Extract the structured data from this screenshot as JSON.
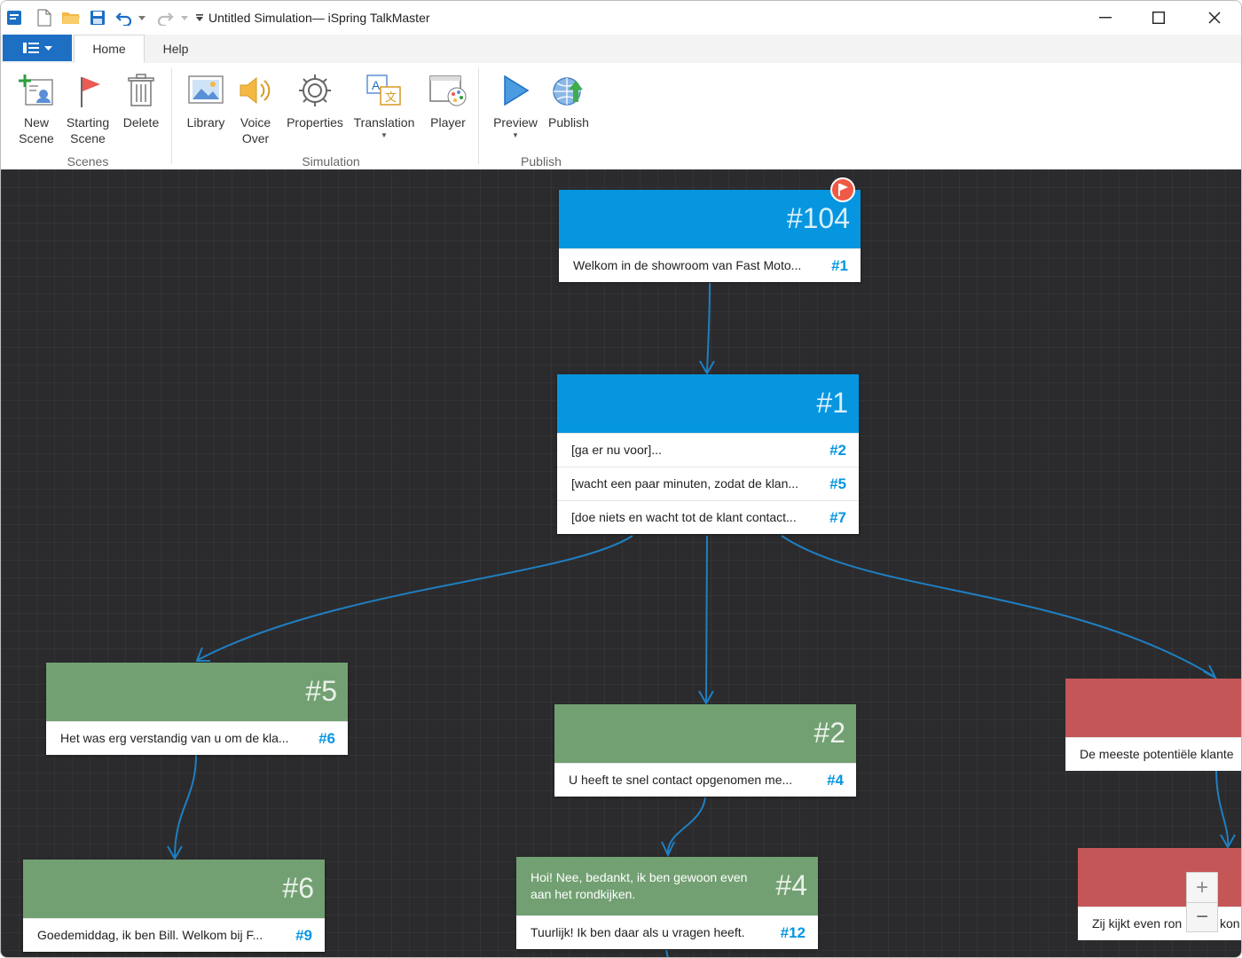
{
  "window": {
    "title": "Untitled Simulation— iSpring TalkMaster"
  },
  "tabs": {
    "home": "Home",
    "help": "Help"
  },
  "ribbon": {
    "new_scene": "New\nScene",
    "starting_scene": "Starting\nScene",
    "delete": "Delete",
    "library": "Library",
    "voice_over": "Voice\nOver",
    "properties": "Properties",
    "translation": "Translation",
    "player": "Player",
    "preview": "Preview",
    "publish": "Publish",
    "groups": {
      "scenes": "Scenes",
      "simulation": "Simulation",
      "publish": "Publish"
    }
  },
  "colors": {
    "accent": "#0696e0",
    "positive": "#72a072",
    "negative": "#c45657",
    "canvas": "#2b2b2d"
  },
  "scenes": {
    "s104": {
      "num": "#104",
      "replies": [
        {
          "text": "Welkom in de showroom van Fast Moto...",
          "link": "#1"
        }
      ]
    },
    "s1": {
      "num": "#1",
      "replies": [
        {
          "text": "[ga er nu voor]...",
          "link": "#2"
        },
        {
          "text": "[wacht een paar minuten, zodat de klan...",
          "link": "#5"
        },
        {
          "text": "[doe niets en wacht tot de klant contact...",
          "link": "#7"
        }
      ]
    },
    "s5": {
      "num": "#5",
      "replies": [
        {
          "text": "Het was erg verstandig van u om de kla...",
          "link": "#6"
        }
      ]
    },
    "s2": {
      "num": "#2",
      "replies": [
        {
          "text": "U heeft te snel contact opgenomen me...",
          "link": "#4"
        }
      ]
    },
    "s7": {
      "replies": [
        {
          "text": "De meeste potentiële klante"
        }
      ]
    },
    "s6": {
      "num": "#6",
      "replies": [
        {
          "text": "Goedemiddag, ik ben Bill. Welkom bij F...",
          "link": "#9"
        }
      ]
    },
    "s4": {
      "num": "#4",
      "speech": "Hoi! Nee, bedankt, ik ben gewoon even aan het rondkijken.",
      "replies": [
        {
          "text": "Tuurlijk! Ik ben daar als u vragen heeft.",
          "link": "#12"
        }
      ]
    },
    "s8": {
      "replies": [
        {
          "text": "Zij kijkt even ron"
        },
        {
          "text": "kon"
        }
      ]
    }
  },
  "zoom": {
    "in": "+",
    "out": "−"
  }
}
